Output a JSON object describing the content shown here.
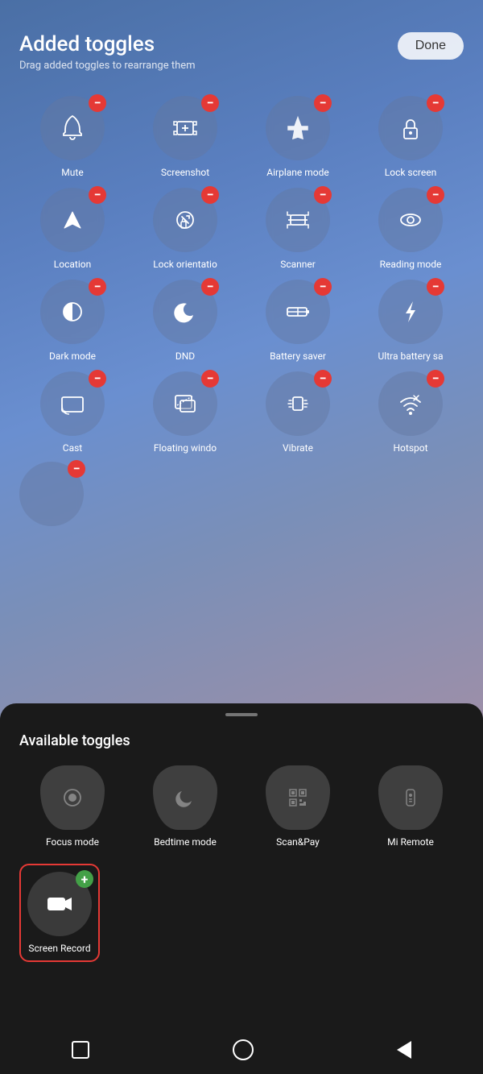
{
  "header": {
    "title": "Added toggles",
    "subtitle": "Drag added toggles to rearrange them",
    "done_label": "Done"
  },
  "added_toggles": [
    {
      "id": "mute",
      "label": "Mute",
      "icon": "bell"
    },
    {
      "id": "screenshot",
      "label": "Screenshot",
      "icon": "screenshot"
    },
    {
      "id": "airplane",
      "label": "Airplane mode",
      "icon": "airplane"
    },
    {
      "id": "lockscreen",
      "label": "Lock screen",
      "icon": "lock"
    },
    {
      "id": "location",
      "label": "Location",
      "icon": "location"
    },
    {
      "id": "lock-orientation",
      "label": "Lock orientatio",
      "icon": "lock-orientation"
    },
    {
      "id": "scanner",
      "label": "Scanner",
      "icon": "scanner"
    },
    {
      "id": "reading-mode",
      "label": "Reading mode",
      "icon": "eye"
    },
    {
      "id": "dark-mode",
      "label": "Dark mode",
      "icon": "half-circle"
    },
    {
      "id": "dnd",
      "label": "DND",
      "icon": "moon"
    },
    {
      "id": "battery-saver",
      "label": "Battery saver",
      "icon": "battery"
    },
    {
      "id": "ultra-battery",
      "label": "Ultra battery sa",
      "icon": "bolt"
    },
    {
      "id": "cast",
      "label": "Cast",
      "icon": "cast"
    },
    {
      "id": "floating-window",
      "label": "Floating windo",
      "icon": "float"
    },
    {
      "id": "vibrate",
      "label": "Vibrate",
      "icon": "vibrate"
    },
    {
      "id": "hotspot",
      "label": "Hotspot",
      "icon": "wifi"
    }
  ],
  "available_section_title": "Available toggles",
  "available_toggles": [
    {
      "id": "focus-mode",
      "label": "Focus mode",
      "icon": "focus"
    },
    {
      "id": "bedtime-mode",
      "label": "Bedtime mode",
      "icon": "bedtime"
    },
    {
      "id": "scan-pay",
      "label": "Scan&Pay",
      "icon": "scanpay"
    },
    {
      "id": "mi-remote",
      "label": "Mi Remote",
      "icon": "remote"
    }
  ],
  "screen_record": {
    "label": "Screen Record",
    "icon": "camera-video"
  },
  "nav": {
    "square": "recent-apps",
    "circle": "home",
    "triangle": "back"
  }
}
